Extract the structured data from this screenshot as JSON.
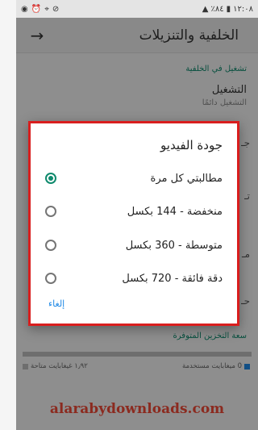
{
  "status_bar": {
    "time": "١٢:٠٨",
    "battery": "٨٤٪",
    "left_icons": [
      "wifi-off-icon",
      "location-icon",
      "alarm-icon",
      "account-icon"
    ]
  },
  "app_bar": {
    "title": "الخلفية والتنزيلات"
  },
  "background_settings": {
    "section_title": "تشغيل في الخلفية",
    "item_title": "التشغيل",
    "item_subtitle": "التشغيل دائمًا"
  },
  "partial_letters": [
    "جـ",
    "تـ",
    "مـ",
    "حـ"
  ],
  "storage": {
    "section_title": "سعة التخزين المتوفرة",
    "available_label": "١٫٩٢ غيغابايت متاحة",
    "used_label": "0 ميغابايت مستخدمة",
    "used_fraction": 0
  },
  "dialog": {
    "title": "جودة الفيديو",
    "options": [
      {
        "label": "مطالبتي كل مرة",
        "selected": true
      },
      {
        "label": "منخفضة - 144 بكسل",
        "selected": false
      },
      {
        "label": "متوسطة - 360 بكسل",
        "selected": false
      },
      {
        "label": "دقة فائقة - 720 بكسل",
        "selected": false
      }
    ],
    "cancel_label": "إلغاء"
  },
  "watermark": "alarabydownloads.com",
  "colors": {
    "accent": "#0f8a6d",
    "dialog_border": "#d91e1e",
    "cancel": "#1e88e5"
  }
}
